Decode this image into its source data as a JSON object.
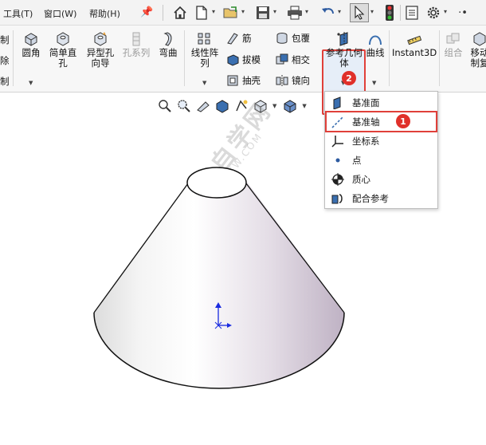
{
  "menu": {
    "tools": "工具(T)",
    "window": "窗口(W)",
    "help": "帮助(H)"
  },
  "ribbon": {
    "left_partial": [
      "制",
      "除",
      "制"
    ],
    "fillet": "圆角",
    "simple_hole": "简单直孔",
    "hole_wizard": "异型孔向导",
    "hole_series": "孔系列",
    "bend": "弯曲",
    "linear_pattern": "线性阵列",
    "rib": "筋",
    "draft": "拔模",
    "shell": "抽壳",
    "wrap": "包覆",
    "intersect": "相交",
    "mirror": "镜向",
    "reference_geometry": "参考几何体",
    "curves": "曲线",
    "instant3d": "Instant3D",
    "combine": "组合",
    "move_copy_partial": "移动制复"
  },
  "dropdown": {
    "items": [
      {
        "label": "基准面",
        "icon": "plane-icon"
      },
      {
        "label": "基准轴",
        "icon": "axis-icon"
      },
      {
        "label": "坐标系",
        "icon": "coordinate-system-icon"
      },
      {
        "label": "点",
        "icon": "point-icon"
      },
      {
        "label": "质心",
        "icon": "center-of-mass-icon"
      },
      {
        "label": "配合参考",
        "icon": "mate-reference-icon"
      }
    ]
  },
  "badges": {
    "step1": "1",
    "step2": "2"
  },
  "watermark": {
    "main": "软件自学网",
    "sub": "WWW.RJZXW.COM"
  },
  "colors": {
    "highlight_red": "#e0403a",
    "badge_red": "#e0302a",
    "axis_blue": "#1a2be0"
  }
}
